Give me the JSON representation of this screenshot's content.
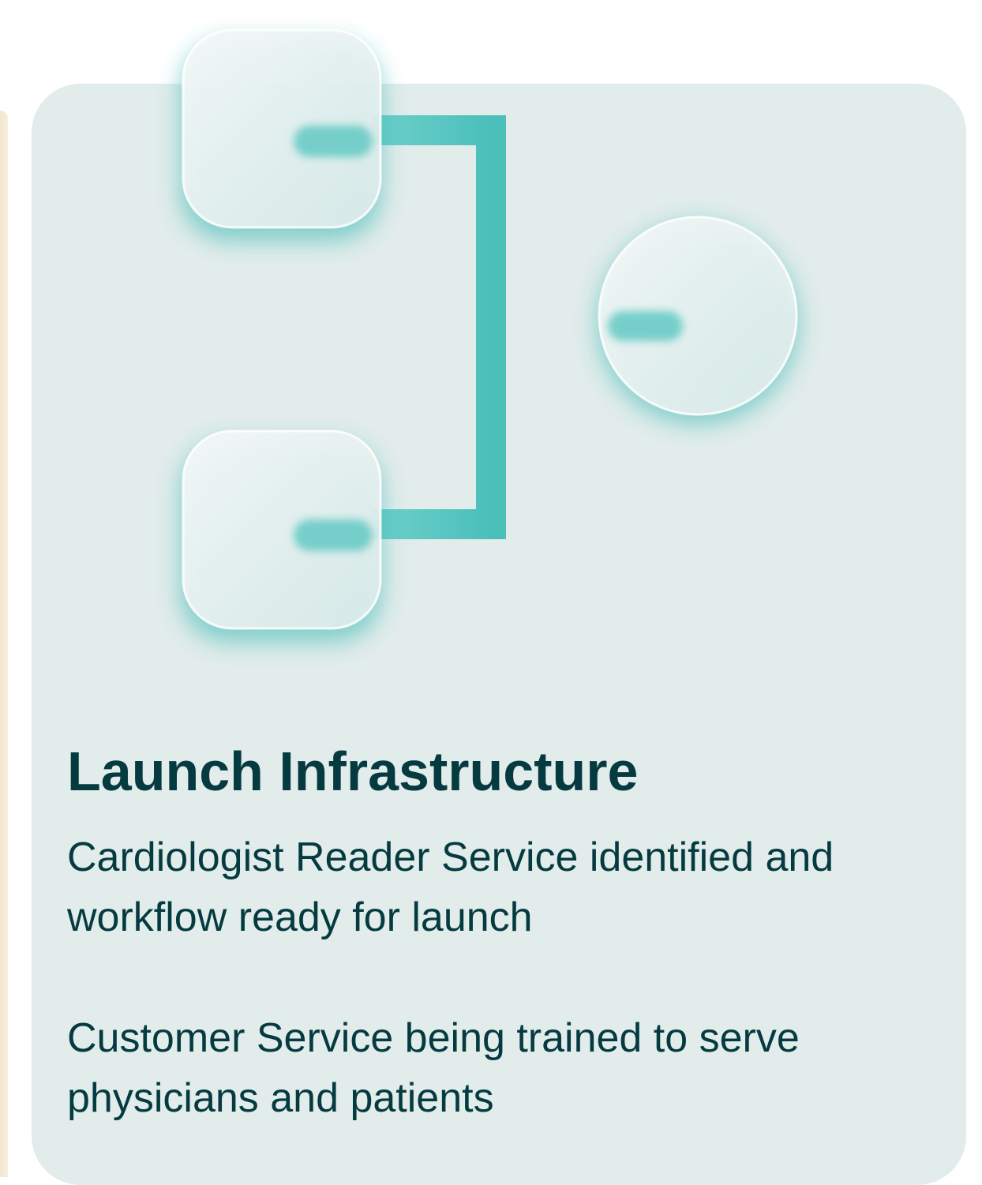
{
  "card": {
    "title": "Launch Infrastructure",
    "description_1": "Cardiologist Reader Service identified and workflow ready for launch",
    "description_2": "Customer Service being trained to serve physicians and patients"
  },
  "colors": {
    "card_background": "#e1eceb",
    "text": "#053b40",
    "accent_teal": "#4fc2be",
    "left_strip": "#f3e6cf"
  },
  "icons": [
    "network-diagram-icon"
  ]
}
